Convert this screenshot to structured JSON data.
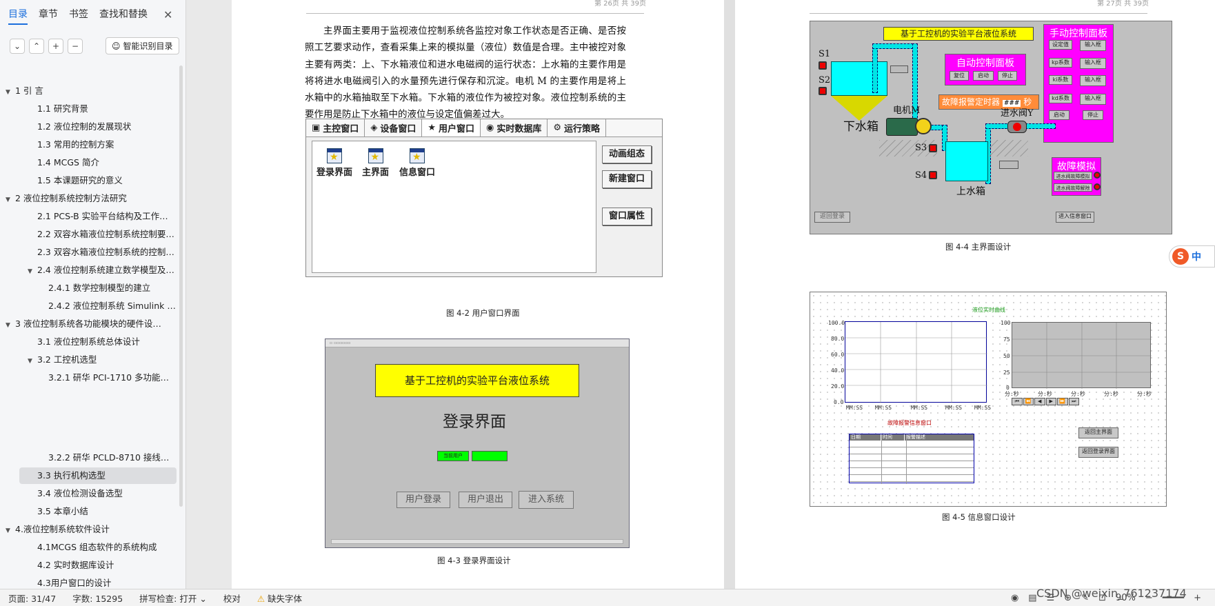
{
  "sidebar": {
    "tabs": [
      "目录",
      "章节",
      "书签",
      "查找和替换"
    ],
    "smart_toc": "智能识别目录",
    "items": [
      {
        "label": "1 引 言",
        "level": 0,
        "arrow": true
      },
      {
        "label": "1.1 研究背景",
        "level": 1
      },
      {
        "label": "1.2 液位控制的发展现状",
        "level": 1
      },
      {
        "label": "1.3 常用的控制方案",
        "level": 1
      },
      {
        "label": "1.4 MCGS 简介",
        "level": 1
      },
      {
        "label": "1.5 本课题研究的意义",
        "level": 1
      },
      {
        "label": "2 液位控制系统控制方法研究",
        "level": 0,
        "arrow": true
      },
      {
        "label": "2.1 PCS-B 实验平台结构及工作原…",
        "level": 1
      },
      {
        "label": "2.2 双容水箱液位控制系统控制要…",
        "level": 1
      },
      {
        "label": "2.3 双容水箱液位控制系统的控制…",
        "level": 1
      },
      {
        "label": "2.4 液位控制系统建立数学模型及…",
        "level": 1,
        "arrow": true
      },
      {
        "label": "2.4.1 数学控制模型的建立",
        "level": 2
      },
      {
        "label": "2.4.2 液位控制系统 Simulink …",
        "level": 2
      },
      {
        "label": "3 液位控制系统各功能模块的硬件设…",
        "level": 0,
        "arrow": true
      },
      {
        "label": "3.1 液位控制系统总体设计",
        "level": 1
      },
      {
        "label": "3.2 工控机选型",
        "level": 1,
        "arrow": true
      },
      {
        "label": "3.2.1 研华 PCI-1710 多功能…",
        "level": 2
      },
      {
        "label": "3.2.2 研华 PCLD-8710 接线…",
        "level": 2
      },
      {
        "label": "3.3 执行机构选型",
        "level": 1,
        "selected": true
      },
      {
        "label": "3.4 液位检测设备选型",
        "level": 1
      },
      {
        "label": "3.5 本章小结",
        "level": 1
      },
      {
        "label": "4.液位控制系统软件设计",
        "level": 0,
        "arrow": true
      },
      {
        "label": "4.1MCGS 组态软件的系统构成",
        "level": 1
      },
      {
        "label": "4.2 实时数据库设计",
        "level": 1
      },
      {
        "label": "4.3用户窗口的设计",
        "level": 1
      }
    ]
  },
  "status": {
    "page": "页面: 31/47",
    "words": "字数: 15295",
    "spell": "拼写检查: 打开 ⌄",
    "proof": "校对",
    "missing_font": "缺失字体",
    "zoom": "90%"
  },
  "page1": {
    "header_right": "第 26页 共 39页",
    "paragraph": "主界面主要用于监视液位控制系统各监控对象工作状态是否正确、是否按照工艺要求动作，查看采集上来的模拟量（液位）数值是合理。主中被控对象主要有两类：上、下水箱液位和进水电磁阀的运行状态：上水箱的主要作用是将将进水电磁阀引入的水量预先进行保存和沉淀。电机 M 的主要作用是将上水箱中的水箱抽取至下水箱。下水箱的液位作为被控对象。液位控制系统的主要作用是防止下水箱中的液位与设定值偏差过大。",
    "uw_tabs": [
      "主控窗口",
      "设备窗口",
      "用户窗口",
      "实时数据库",
      "运行策略"
    ],
    "uw_icons": [
      "登录界面",
      "主界面",
      "信息窗口"
    ],
    "uw_buttons": [
      "动画组态",
      "新建窗口",
      "窗口属性"
    ],
    "caption1": "图 4-2  用户窗口界面",
    "login_title": "基于工控机的实验平台液位系统",
    "login_heading": "登录界面",
    "login_user_label": "当前用户",
    "login_buttons": [
      "用户登录",
      "用户退出",
      "进入系统"
    ],
    "caption2": "图 4-3  登录界面设计"
  },
  "page2": {
    "header_right": "第 27页 共 39页",
    "main_title": "基于工控机的实验平台液位系统",
    "auto_panel": "自动控制面板",
    "auto_btns": [
      "复位",
      "启动",
      "停止"
    ],
    "alarm_timer": "故障报警定时器",
    "alarm_value": "###",
    "alarm_unit": "秒",
    "manual_panel": "手动控制面板",
    "manual_rows": [
      [
        "设定值",
        "输入框"
      ],
      [
        "kp系数",
        "输入框"
      ],
      [
        "ki系数",
        "输入框"
      ],
      [
        "kd系数",
        "输入框"
      ]
    ],
    "manual_btns": [
      "启动",
      "停止"
    ],
    "fault_panel": "故障模拟",
    "fault_btns": [
      "进水阀故障模拟",
      "进水阀故障解除"
    ],
    "labels": {
      "s1": "S1",
      "s2": "S2",
      "s3": "S3",
      "s4": "S4",
      "motor": "电机M",
      "valve": "进水阀Y",
      "lower_tank": "下水箱",
      "upper_tank": "上水箱"
    },
    "back_btn": "返回登录",
    "enter_info_btn": "进入信息窗口",
    "caption4": "图 4-4  主界面设计",
    "info_title": "液位实时曲线",
    "y_ticks": [
      "100.0",
      "80.0",
      "60.0",
      "40.0",
      "20.0",
      "0.0"
    ],
    "x_ticks": [
      "MM:SS",
      "MM:SS",
      "MM:SS",
      "MM:SS",
      "MM:SS"
    ],
    "y2_ticks": [
      "100",
      "75",
      "50",
      "25",
      "0"
    ],
    "x2_ticks": [
      "分:秒",
      "分:秒",
      "分:秒",
      "分:秒",
      "分:秒"
    ],
    "alarm_window_title": "故障报警信息窗口",
    "alarm_cols": [
      "日期",
      "时间",
      "报警描述"
    ],
    "info_btns": [
      "返回主界面",
      "返回登录界面"
    ],
    "caption5": "图 4-5  信息窗口设计"
  },
  "ime": {
    "label": "中"
  },
  "watermark": "CSDN @weixin_761237174"
}
